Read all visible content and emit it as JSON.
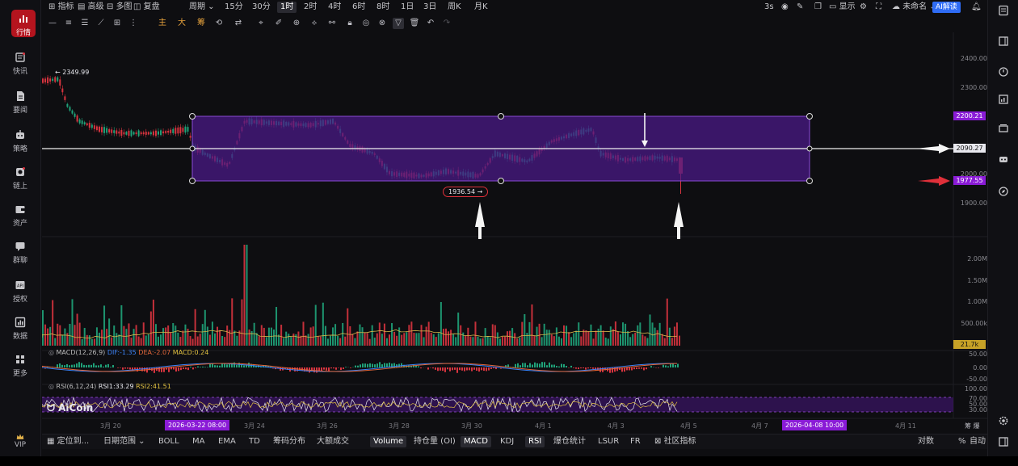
{
  "sidebar": {
    "items": [
      {
        "label": "行情",
        "icon": "bar-chart-icon"
      },
      {
        "label": "快讯",
        "icon": "news-icon"
      },
      {
        "label": "要闻",
        "icon": "document-icon"
      },
      {
        "label": "策略",
        "icon": "robot-icon"
      },
      {
        "label": "链上",
        "icon": "chain-icon"
      },
      {
        "label": "资产",
        "icon": "wallet-icon"
      },
      {
        "label": "群聊",
        "icon": "chat-icon"
      },
      {
        "label": "授权",
        "icon": "api-key-icon"
      },
      {
        "label": "数据",
        "icon": "data-icon"
      },
      {
        "label": "更多",
        "icon": "grid-icon"
      }
    ],
    "vip": "VIP"
  },
  "toolbar": {
    "indicators": "指标",
    "advanced": "高级",
    "multi_chart": "多图",
    "replay": "复盘",
    "period": "周期",
    "intervals": [
      "15分",
      "30分",
      "1时",
      "2时",
      "4时",
      "6时",
      "8时",
      "1日",
      "3日",
      "周K",
      "月K"
    ],
    "active_interval": "1时",
    "refresh": "3s",
    "display": "显示",
    "layout_name": "未命名",
    "ai_button": "AI解读"
  },
  "drawtools": {
    "main": "主",
    "big": "大",
    "chips": "筹"
  },
  "price_axis": {
    "ticks": [
      "2400.00",
      "2300.00",
      "2200.00",
      "2100.00",
      "2000.00",
      "1900.00"
    ],
    "badges": [
      {
        "value": "2200.21",
        "color": "#8a1bd6"
      },
      {
        "value": "2090.27",
        "color": "#e8e8ee"
      },
      {
        "value": "1977.55",
        "color": "#8a1bd6"
      }
    ],
    "high_label": "2349.99",
    "low_label": "1936.54"
  },
  "volume_axis": {
    "ticks": [
      "2.00M",
      "1.50M",
      "1.00M",
      "500.00k"
    ],
    "current": "21.7k"
  },
  "macd": {
    "name": "MACD(12,26,9)",
    "dif": "DIF:-1.35",
    "dea": "DEA:-2.07",
    "macd": "MACD:0.24",
    "ticks": [
      "50.00",
      "0.00",
      "-50.00"
    ]
  },
  "rsi": {
    "name": "RSI(6,12,24)",
    "rsi1": "RSI1:33.29",
    "rsi2": "RSI2:41.51",
    "ticks": [
      "100.00",
      "70.00",
      "50.00",
      "30.00"
    ]
  },
  "watermark": "AiCoin",
  "time_axis": {
    "ticks": [
      "3月 20",
      "3月 24",
      "3月 26",
      "3月 28",
      "3月 30",
      "4月 1",
      "4月 3",
      "4月 5",
      "4月 7",
      "4月 11"
    ],
    "start_badge": "2026-03-22 08:00",
    "end_badge": "2026-04-08 10:00",
    "corner": "筹 爆"
  },
  "bottombar": {
    "locate": "定位到...",
    "date_range": "日期范围",
    "items": [
      "BOLL",
      "MA",
      "EMA",
      "TD",
      "筹码分布",
      "大额成交",
      "Volume",
      "持仓量 (OI)",
      "MACD",
      "KDJ",
      "RSI",
      "爆仓统计",
      "LSUR",
      "FR",
      "社区指标"
    ],
    "active": [
      "Volume",
      "MACD",
      "RSI"
    ],
    "right": [
      "对数",
      "%",
      "自动"
    ]
  },
  "colors": {
    "up": "#1fa37a",
    "down": "#d8343f",
    "box_fill": "#4a1a86",
    "box_stroke": "#8a4bd6",
    "sidebar_active": "#b4141e",
    "accent_purple": "#8a1bd6",
    "ai_blue": "#2f6cf5"
  }
}
